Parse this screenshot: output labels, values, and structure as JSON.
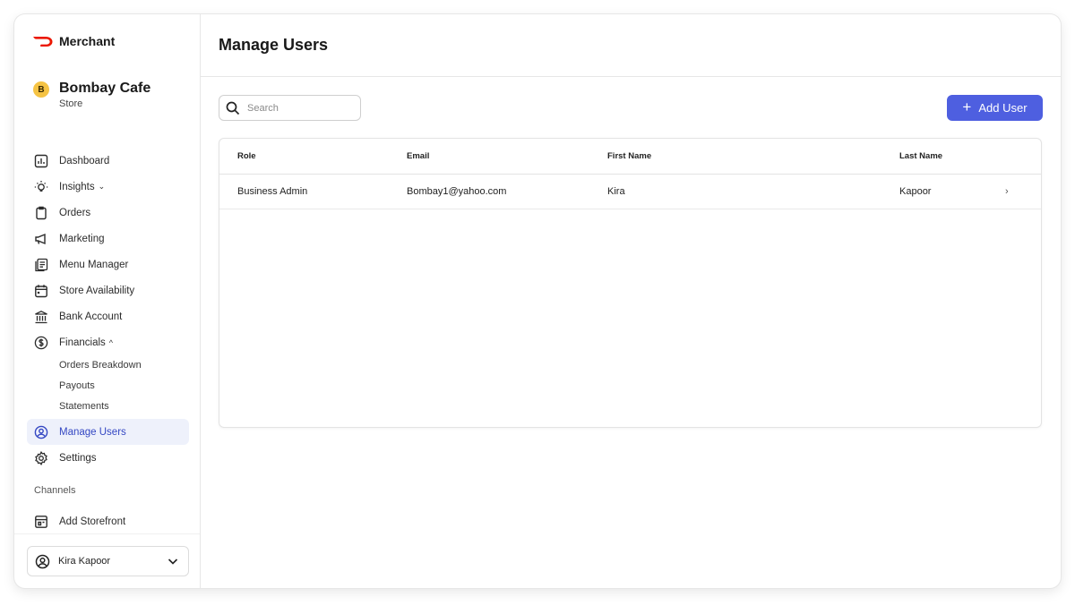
{
  "brand": {
    "name": "Merchant",
    "logo_color": "#eb1700"
  },
  "store": {
    "badge": "B",
    "name": "Bombay Cafe",
    "type": "Store"
  },
  "nav": {
    "items": [
      {
        "label": "Dashboard",
        "icon": "dashboard-icon"
      },
      {
        "label": "Insights",
        "icon": "lightbulb-icon",
        "caret": "⌄"
      },
      {
        "label": "Orders",
        "icon": "clipboard-icon"
      },
      {
        "label": "Marketing",
        "icon": "megaphone-icon"
      },
      {
        "label": "Menu Manager",
        "icon": "menu-book-icon"
      },
      {
        "label": "Store Availability",
        "icon": "calendar-icon"
      },
      {
        "label": "Bank Account",
        "icon": "bank-icon"
      },
      {
        "label": "Financials",
        "icon": "dollar-circle-icon",
        "caret": "^"
      }
    ],
    "financials_sub": [
      "Orders Breakdown",
      "Payouts",
      "Statements"
    ],
    "manage_users": {
      "label": "Manage Users",
      "icon": "user-circle-icon",
      "active": true
    },
    "settings": {
      "label": "Settings",
      "icon": "gear-icon"
    },
    "channels_label": "Channels",
    "add_storefront": {
      "label": "Add Storefront",
      "icon": "storefront-icon"
    }
  },
  "user": {
    "name": "Kira Kapoor",
    "icon": "user-circle-icon"
  },
  "main": {
    "title": "Manage Users",
    "search": {
      "placeholder": "Search",
      "value": ""
    },
    "add_button": "Add User",
    "table": {
      "headers": [
        "Role",
        "Email",
        "First Name",
        "Last Name"
      ],
      "rows": [
        {
          "role": "Business Admin",
          "email": "Bombay1@yahoo.com",
          "first": "Kira",
          "last": "Kapoor"
        }
      ]
    }
  },
  "colors": {
    "accent": "#4e5fe0",
    "active_bg": "#eef1fb",
    "active_text": "#3447c3",
    "badge": "#f5c344"
  }
}
